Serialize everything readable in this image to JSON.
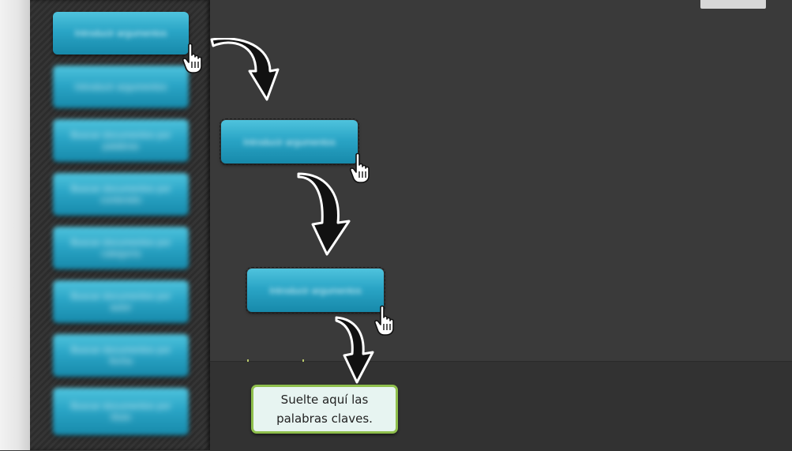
{
  "sidebar": {
    "items": [
      {
        "label": "Introducir argumentos"
      },
      {
        "label": "Introducir argumentos"
      },
      {
        "label": "Buscar documentos por palabras"
      },
      {
        "label": "Buscar documentos por contenido"
      },
      {
        "label": "Buscar documentos por categoría"
      },
      {
        "label": "Buscar documentos por autor"
      },
      {
        "label": "Buscar documentos por fecha"
      },
      {
        "label": "Buscar documentos por título"
      }
    ]
  },
  "steps": [
    {
      "label": "Introducir argumentos"
    },
    {
      "label": "Introducir argumentos"
    }
  ],
  "dropzone": {
    "line1": "Suelte aquí las",
    "line2": "palabras claves."
  },
  "colors": {
    "tile": "#2aa5c6",
    "dropzone_border": "#8fbf4d",
    "dropzone_fill": "#e7f4f1",
    "background": "#3b3b3b"
  },
  "icons": [
    "pointer-hand-icon",
    "curved-arrow-down-icon"
  ]
}
